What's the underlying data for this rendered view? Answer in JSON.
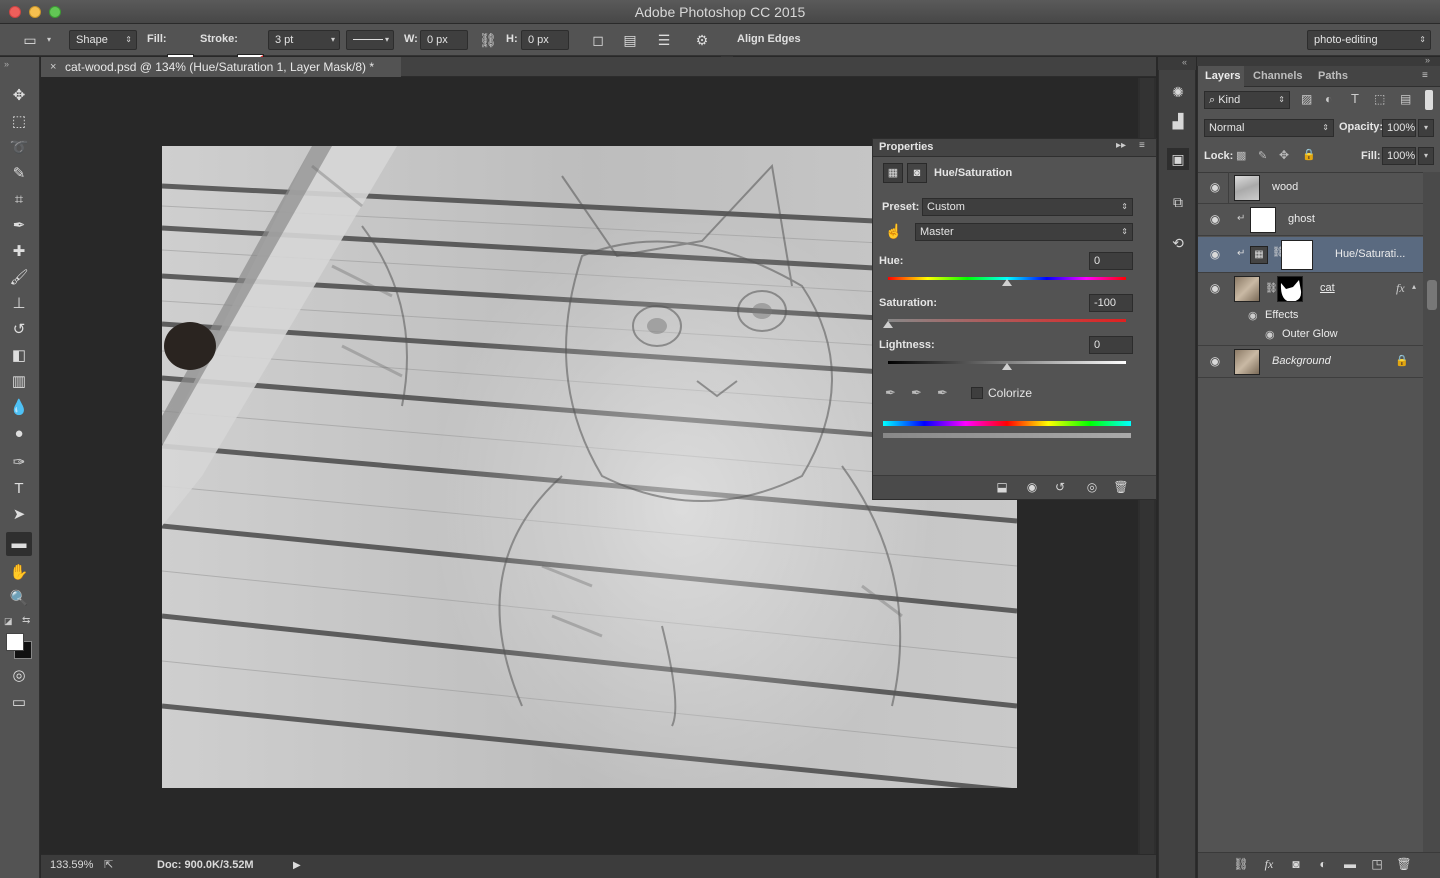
{
  "app": {
    "title": "Adobe Photoshop CC 2015"
  },
  "options_bar": {
    "mode": "Shape",
    "fill_label": "Fill:",
    "stroke_label": "Stroke:",
    "stroke_width": "3 pt",
    "w_label": "W:",
    "w_value": "0 px",
    "h_label": "H:",
    "h_value": "0 px",
    "align_edges": "Align Edges",
    "workspace": "photo-editing"
  },
  "document": {
    "tab_title": "cat-wood.psd @ 134% (Hue/Saturation 1, Layer Mask/8) *",
    "zoom": "133.59%",
    "doc_size": "Doc: 900.0K/3.52M"
  },
  "properties": {
    "panel_title": "Properties",
    "adjustment_title": "Hue/Saturation",
    "preset_label": "Preset:",
    "preset_value": "Custom",
    "channel": "Master",
    "hue_label": "Hue:",
    "hue_value": "0",
    "hue_level": 0.5,
    "saturation_label": "Saturation:",
    "saturation_value": "-100",
    "saturation_level": 0.0,
    "lightness_label": "Lightness:",
    "lightness_value": "0",
    "lightness_level": 0.5,
    "colorize_label": "Colorize",
    "colorize_checked": false
  },
  "layers_panel": {
    "tabs": [
      "Layers",
      "Channels",
      "Paths"
    ],
    "filter_kind": "Kind",
    "blend_mode": "Normal",
    "opacity_label": "Opacity:",
    "opacity_value": "100%",
    "lock_label": "Lock:",
    "fill_label": "Fill:",
    "fill_value": "100%",
    "layers": [
      {
        "name": "wood",
        "visible": true
      },
      {
        "name": "ghost",
        "visible": true,
        "clipped": true
      },
      {
        "name": "Hue/Saturati...",
        "visible": true,
        "clipped": true,
        "selected": true
      },
      {
        "name": "cat",
        "visible": true,
        "has_fx": true
      },
      {
        "name": "Effects"
      },
      {
        "name": "Outer Glow"
      },
      {
        "name": "Background",
        "visible": true,
        "locked": true
      }
    ],
    "fx_label": "fx"
  },
  "colors": {
    "selected_layer": "#5a6a80",
    "panel_bg": "#535353",
    "canvas_bg": "#282828"
  }
}
